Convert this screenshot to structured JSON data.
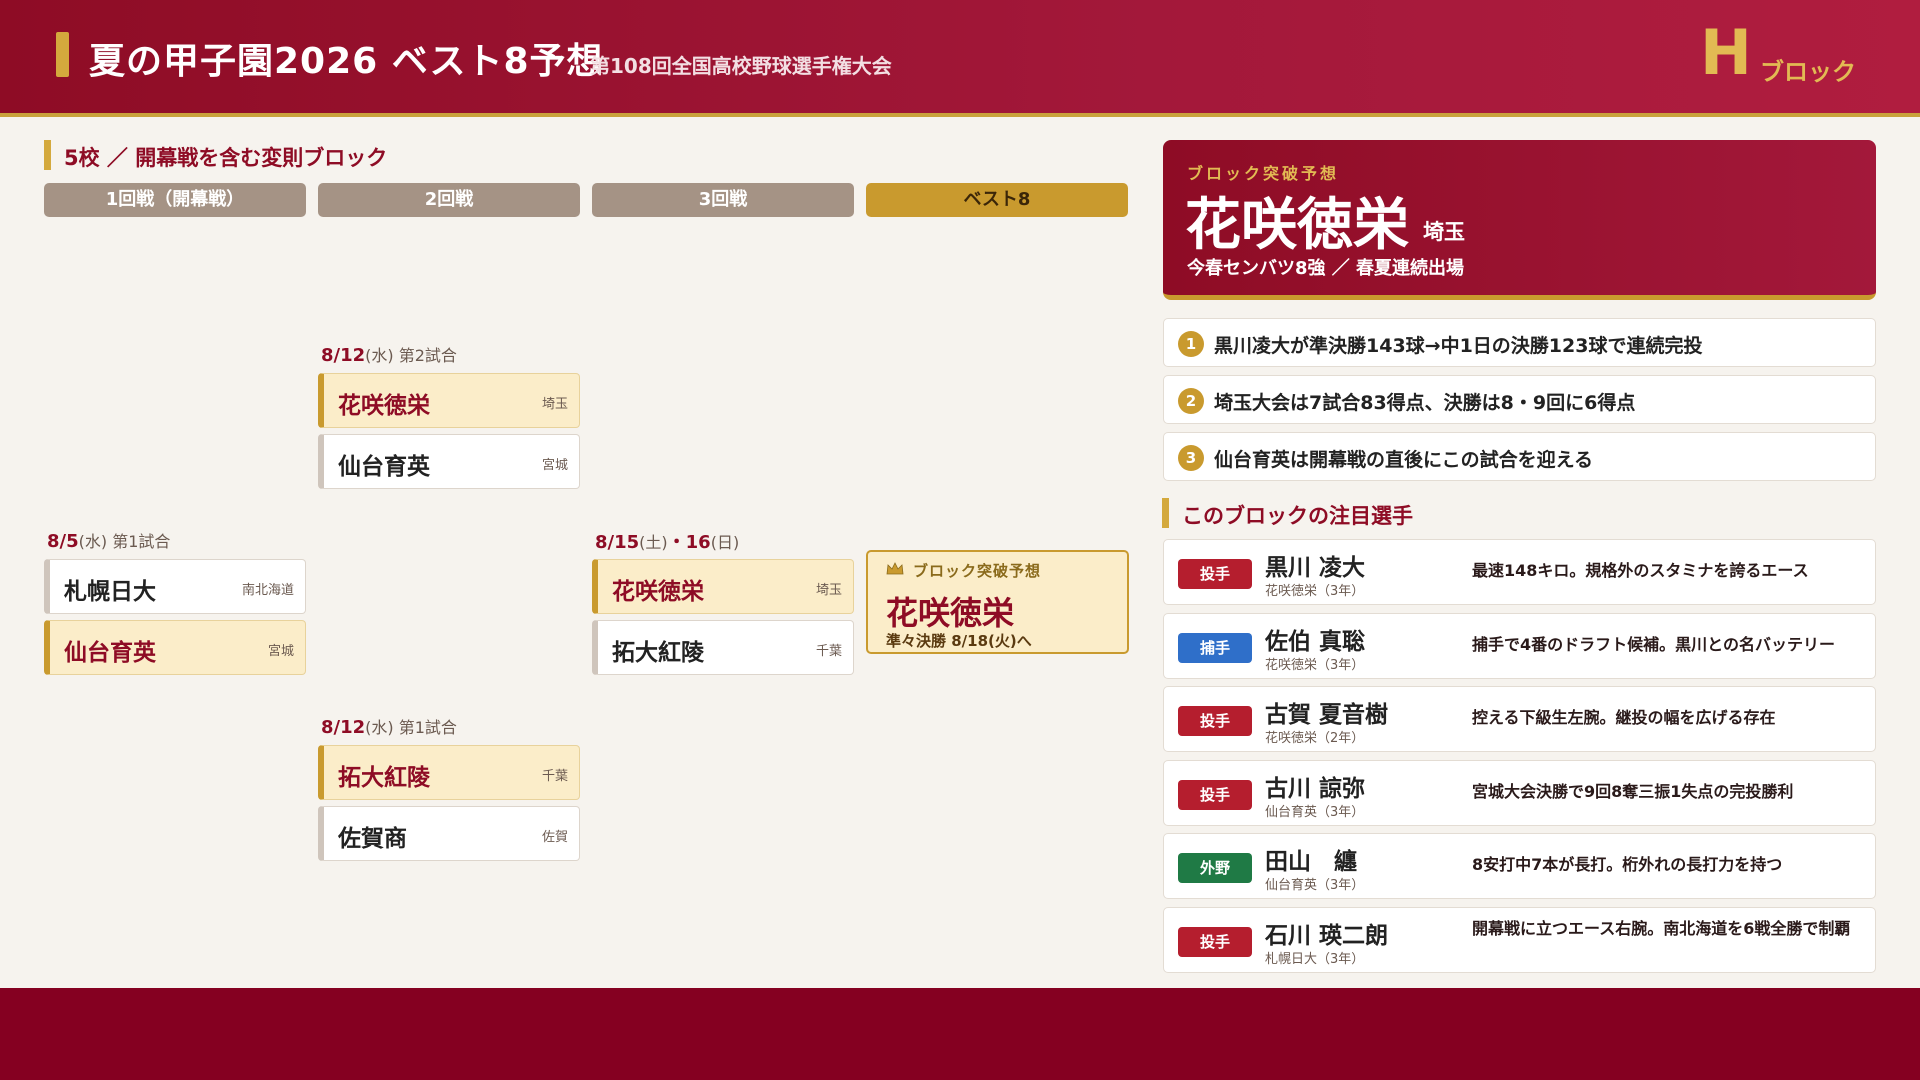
{
  "header": {
    "title": "夏の甲子園2026 ベスト8予想",
    "subtitle": "第108回全国高校野球選手権大会",
    "block_letter": "H",
    "block_word": "ブロック"
  },
  "bracket": {
    "section_title": "5校 ／ 開幕戦を含む変則ブロック",
    "rounds": [
      "1回戦（開幕戦）",
      "2回戦",
      "3回戦",
      "ベスト8"
    ],
    "r1_meta": {
      "date": "8/5",
      "day": "(水)",
      "slot": "第1試合"
    },
    "r1_teams": [
      {
        "name": "札幌日大",
        "pref": "南北海道"
      },
      {
        "name": "仙台育英",
        "pref": "宮城"
      }
    ],
    "r2a_meta": {
      "date": "8/12",
      "day": "(水)",
      "slot": "第2試合"
    },
    "r2a_teams": [
      {
        "name": "花咲徳栄",
        "pref": "埼玉"
      },
      {
        "name": "仙台育英",
        "pref": "宮城"
      }
    ],
    "r2b_meta": {
      "date": "8/12",
      "day": "(水)",
      "slot": "第1試合"
    },
    "r2b_teams": [
      {
        "name": "拓大紅陵",
        "pref": "千葉"
      },
      {
        "name": "佐賀商",
        "pref": "佐賀"
      }
    ],
    "r3_meta": {
      "date": "8/15",
      "day": "(土)",
      "sep": "・",
      "date2": "16",
      "day2": "(日)"
    },
    "r3_teams": [
      {
        "name": "花咲徳栄",
        "pref": "埼玉"
      },
      {
        "name": "拓大紅陵",
        "pref": "千葉"
      }
    ],
    "best8": {
      "label": "ブロック突破予想",
      "name": "花咲徳栄",
      "next": "準々決勝 8/18(火)へ"
    }
  },
  "prediction": {
    "label": "ブロック突破予想",
    "school": "花咲徳栄",
    "pref": "埼玉",
    "note": "今春センバツ8強 ／ 春夏連続出場"
  },
  "points": [
    {
      "num": "1",
      "text": "黒川凌大が準決勝143球→中1日の決勝123球で連続完投"
    },
    {
      "num": "2",
      "text": "埼玉大会は7試合83得点、決勝は8・9回に6得点"
    },
    {
      "num": "3",
      "text": "仙台育英は開幕戦の直後にこの試合を迎える"
    }
  ],
  "players_title": "このブロックの注目選手",
  "players": [
    {
      "pos": "投手",
      "name": "黒川 凌大",
      "school": "花咲徳栄（3年）",
      "desc": "最速148キロ。規格外のスタミナを誇るエース"
    },
    {
      "pos": "捕手",
      "name": "佐伯 真聡",
      "school": "花咲徳栄（3年）",
      "desc": "捕手で4番のドラフト候補。黒川との名バッテリー"
    },
    {
      "pos": "投手",
      "name": "古賀 夏音樹",
      "school": "花咲徳栄（2年）",
      "desc": "控える下級生左腕。継投の幅を広げる存在"
    },
    {
      "pos": "投手",
      "name": "古川 諒弥",
      "school": "仙台育英（3年）",
      "desc": "宮城大会決勝で9回8奪三振1失点の完投勝利"
    },
    {
      "pos": "外野",
      "name": "田山　纏",
      "school": "仙台育英（3年）",
      "desc": "8安打中7本が長打。桁外れの長打力を持つ"
    },
    {
      "pos": "投手",
      "name": "石川 瑛二朗",
      "school": "札幌日大（3年）",
      "desc": "開幕戦に立つエース右腕。南北海道を6戦全勝で制覇"
    }
  ],
  "colors": {
    "header": "#8e0c25",
    "gold": "#c99a2e",
    "pitcher": "#b51e2e",
    "catcher": "#2f6fc9",
    "outfield": "#1f7a45",
    "footer": "#850021"
  }
}
